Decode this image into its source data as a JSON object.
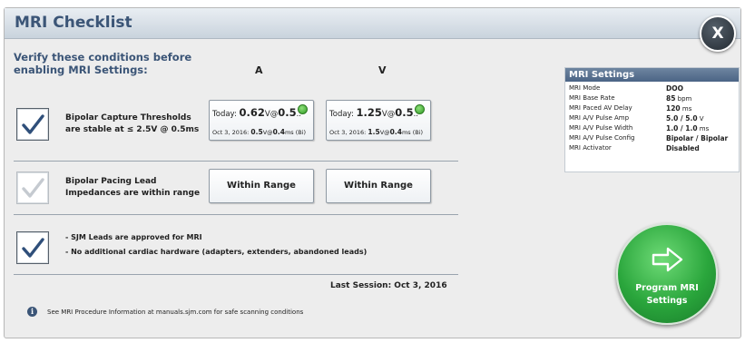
{
  "dialog": {
    "title": "MRI Checklist",
    "close_label": "X",
    "verify_text": "Verify these conditions before enabling MRI Settings:",
    "column_a": "A",
    "column_v": "V"
  },
  "rows": {
    "capture": {
      "checked": true,
      "label": "Bipolar Capture Thresholds are stable at ≤ 2.5V @ 0.5ms",
      "a": {
        "today_prefix": "Today:",
        "today_value": "0.62",
        "today_unit": "V@",
        "today_pw": "0.5",
        "today_rest": "..",
        "prev_date": "Oct 3, 2016:",
        "prev_value": "0.5",
        "prev_unit": "V@",
        "prev_pw": "0.4",
        "prev_suffix": "ms (Bi)",
        "status": "ok"
      },
      "v": {
        "today_prefix": "Today:",
        "today_value": "1.25",
        "today_unit": "V@",
        "today_pw": "0.5",
        "today_rest": "..",
        "prev_date": "Oct 3, 2016:",
        "prev_value": "1.5",
        "prev_unit": "V@",
        "prev_pw": "0.4",
        "prev_suffix": "ms (Bi)",
        "status": "ok"
      }
    },
    "impedance": {
      "checked": true,
      "disabled": true,
      "label": "Bipolar Pacing Lead Impedances are within range",
      "a_button": "Within Range",
      "v_button": "Within Range"
    },
    "leads": {
      "checked": true,
      "line1": "- SJM Leads are approved for MRI",
      "line2": "- No additional cardiac hardware (adapters, extenders, abandoned leads)"
    }
  },
  "last_session": "Last Session: Oct 3, 2016",
  "info": {
    "icon": "info-icon",
    "text": "See MRI Procedure Information at manuals.sjm.com for safe scanning conditions"
  },
  "settings": {
    "title": "MRI Settings",
    "items": [
      {
        "key": "MRI Mode",
        "value": "DOO",
        "unit": ""
      },
      {
        "key": "MRI Base Rate",
        "value": "85",
        "unit": " bpm"
      },
      {
        "key": "MRI Paced AV Delay",
        "value": "120",
        "unit": " ms"
      },
      {
        "key": "MRI A/V Pulse Amp",
        "value": "5.0 / 5.0",
        "unit": " V"
      },
      {
        "key": "MRI A/V Pulse Width",
        "value": "1.0 / 1.0",
        "unit": " ms"
      },
      {
        "key": "MRI A/V Pulse Config",
        "value": "Bipolar / Bipolar",
        "unit": ""
      },
      {
        "key": "MRI Activator",
        "value": "Disabled",
        "unit": ""
      }
    ]
  },
  "program_button": {
    "line1": "Program MRI",
    "line2": "Settings",
    "icon": "arrow-right-icon"
  },
  "colors": {
    "title": "#3b5577",
    "program_green": "#2aa63c",
    "ok_green": "#2f9a24"
  }
}
